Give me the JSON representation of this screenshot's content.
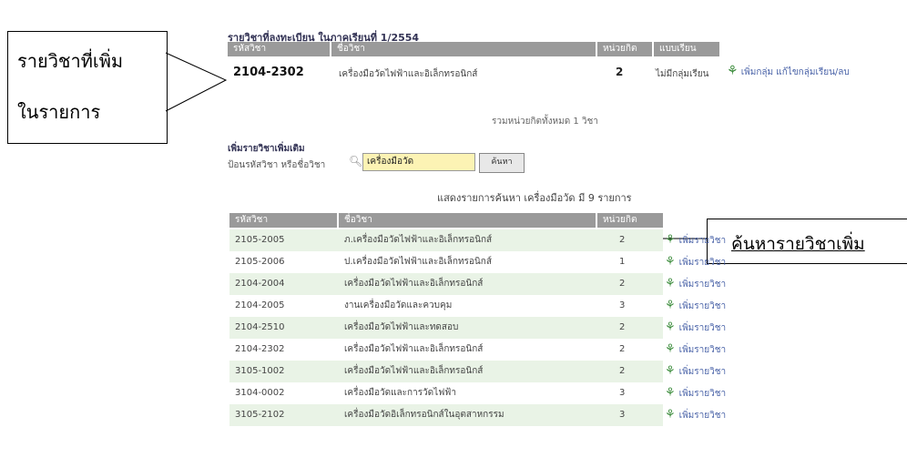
{
  "callouts": {
    "added_line1": "รายวิชาที่เพิ่ม",
    "added_line2": "ในรายการ",
    "search": "ค้นหารายวิชาเพิ่ม"
  },
  "registered": {
    "title": "รายวิชาที่ลงทะเบียน ในภาคเรียนที่ 1/2554",
    "headers": [
      "รหัสวิชา",
      "ชื่อวิชา",
      "หน่วยกิต",
      "แบบเรียน"
    ],
    "row": {
      "code": "2104-2302",
      "name": "เครื่องมือวัดไฟฟ้าและอิเล็กทรอนิกส์",
      "credit": "2",
      "type": "ไม่มีกลุ่มเรียน",
      "action": "เพิ่มกลุ่ม แก้ไขกลุ่มเรียน/ลบ"
    },
    "summary": "รวมหน่วยกิตทั้งหมด 1 วิชา"
  },
  "search": {
    "section_title": "เพิ่มรายวิชาเพิ่มเติม",
    "label": "ป้อนรหัสวิชา หรือชื่อวิชา",
    "value": "เครื่องมือวัด",
    "button": "ค้นหา",
    "result_text": "แสดงรายการค้นหา เครื่องมือวัด มี 9 รายการ"
  },
  "results": {
    "headers": [
      "รหัสวิชา",
      "ชื่อวิชา",
      "หน่วยกิต"
    ],
    "action_label": "เพิ่มรายวิชา",
    "rows": [
      {
        "code": "2105-2005",
        "name": "ภ.เครื่องมือวัดไฟฟ้าและอิเล็กทรอนิกส์",
        "credit": "2"
      },
      {
        "code": "2105-2006",
        "name": "ป.เครื่องมือวัดไฟฟ้าและอิเล็กทรอนิกส์",
        "credit": "1"
      },
      {
        "code": "2104-2004",
        "name": "เครื่องมือวัดไฟฟ้าและอิเล็กทรอนิกส์",
        "credit": "2"
      },
      {
        "code": "2104-2005",
        "name": "งานเครื่องมือวัดและควบคุม",
        "credit": "3"
      },
      {
        "code": "2104-2510",
        "name": "เครื่องมือวัดไฟฟ้าและทดสอบ",
        "credit": "2"
      },
      {
        "code": "2104-2302",
        "name": "เครื่องมือวัดไฟฟ้าและอิเล็กทรอนิกส์",
        "credit": "2"
      },
      {
        "code": "3105-1002",
        "name": "เครื่องมือวัดไฟฟ้าและอิเล็กทรอนิกส์",
        "credit": "2"
      },
      {
        "code": "3104-0002",
        "name": "เครื่องมือวัดและการวัดไฟฟ้า",
        "credit": "3"
      },
      {
        "code": "3105-2102",
        "name": "เครื่องมือวัดอิเล็กทรอนิกส์ในอุตสาหกรรม",
        "credit": "3"
      }
    ]
  }
}
